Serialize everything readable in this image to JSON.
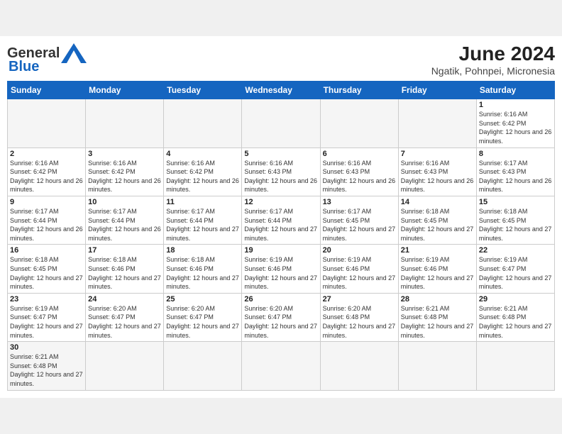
{
  "header": {
    "logo_line1": "General",
    "logo_line2": "Blue",
    "title": "June 2024",
    "subtitle": "Ngatik, Pohnpei, Micronesia"
  },
  "days_of_week": [
    "Sunday",
    "Monday",
    "Tuesday",
    "Wednesday",
    "Thursday",
    "Friday",
    "Saturday"
  ],
  "weeks": [
    [
      {
        "day": "",
        "empty": true
      },
      {
        "day": "",
        "empty": true
      },
      {
        "day": "",
        "empty": true
      },
      {
        "day": "",
        "empty": true
      },
      {
        "day": "",
        "empty": true
      },
      {
        "day": "",
        "empty": true
      },
      {
        "day": "1",
        "sunrise": "6:16 AM",
        "sunset": "6:42 PM",
        "daylight_h": "12",
        "daylight_m": "26"
      }
    ],
    [
      {
        "day": "2",
        "sunrise": "6:16 AM",
        "sunset": "6:42 PM",
        "daylight_h": "12",
        "daylight_m": "26"
      },
      {
        "day": "3",
        "sunrise": "6:16 AM",
        "sunset": "6:42 PM",
        "daylight_h": "12",
        "daylight_m": "26"
      },
      {
        "day": "4",
        "sunrise": "6:16 AM",
        "sunset": "6:42 PM",
        "daylight_h": "12",
        "daylight_m": "26"
      },
      {
        "day": "5",
        "sunrise": "6:16 AM",
        "sunset": "6:43 PM",
        "daylight_h": "12",
        "daylight_m": "26"
      },
      {
        "day": "6",
        "sunrise": "6:16 AM",
        "sunset": "6:43 PM",
        "daylight_h": "12",
        "daylight_m": "26"
      },
      {
        "day": "7",
        "sunrise": "6:16 AM",
        "sunset": "6:43 PM",
        "daylight_h": "12",
        "daylight_m": "26"
      },
      {
        "day": "8",
        "sunrise": "6:17 AM",
        "sunset": "6:43 PM",
        "daylight_h": "12",
        "daylight_m": "26"
      }
    ],
    [
      {
        "day": "9",
        "sunrise": "6:17 AM",
        "sunset": "6:44 PM",
        "daylight_h": "12",
        "daylight_m": "26"
      },
      {
        "day": "10",
        "sunrise": "6:17 AM",
        "sunset": "6:44 PM",
        "daylight_h": "12",
        "daylight_m": "26"
      },
      {
        "day": "11",
        "sunrise": "6:17 AM",
        "sunset": "6:44 PM",
        "daylight_h": "12",
        "daylight_m": "27"
      },
      {
        "day": "12",
        "sunrise": "6:17 AM",
        "sunset": "6:44 PM",
        "daylight_h": "12",
        "daylight_m": "27"
      },
      {
        "day": "13",
        "sunrise": "6:17 AM",
        "sunset": "6:45 PM",
        "daylight_h": "12",
        "daylight_m": "27"
      },
      {
        "day": "14",
        "sunrise": "6:18 AM",
        "sunset": "6:45 PM",
        "daylight_h": "12",
        "daylight_m": "27"
      },
      {
        "day": "15",
        "sunrise": "6:18 AM",
        "sunset": "6:45 PM",
        "daylight_h": "12",
        "daylight_m": "27"
      }
    ],
    [
      {
        "day": "16",
        "sunrise": "6:18 AM",
        "sunset": "6:45 PM",
        "daylight_h": "12",
        "daylight_m": "27"
      },
      {
        "day": "17",
        "sunrise": "6:18 AM",
        "sunset": "6:46 PM",
        "daylight_h": "12",
        "daylight_m": "27"
      },
      {
        "day": "18",
        "sunrise": "6:18 AM",
        "sunset": "6:46 PM",
        "daylight_h": "12",
        "daylight_m": "27"
      },
      {
        "day": "19",
        "sunrise": "6:19 AM",
        "sunset": "6:46 PM",
        "daylight_h": "12",
        "daylight_m": "27"
      },
      {
        "day": "20",
        "sunrise": "6:19 AM",
        "sunset": "6:46 PM",
        "daylight_h": "12",
        "daylight_m": "27"
      },
      {
        "day": "21",
        "sunrise": "6:19 AM",
        "sunset": "6:46 PM",
        "daylight_h": "12",
        "daylight_m": "27"
      },
      {
        "day": "22",
        "sunrise": "6:19 AM",
        "sunset": "6:47 PM",
        "daylight_h": "12",
        "daylight_m": "27"
      }
    ],
    [
      {
        "day": "23",
        "sunrise": "6:19 AM",
        "sunset": "6:47 PM",
        "daylight_h": "12",
        "daylight_m": "27"
      },
      {
        "day": "24",
        "sunrise": "6:20 AM",
        "sunset": "6:47 PM",
        "daylight_h": "12",
        "daylight_m": "27"
      },
      {
        "day": "25",
        "sunrise": "6:20 AM",
        "sunset": "6:47 PM",
        "daylight_h": "12",
        "daylight_m": "27"
      },
      {
        "day": "26",
        "sunrise": "6:20 AM",
        "sunset": "6:47 PM",
        "daylight_h": "12",
        "daylight_m": "27"
      },
      {
        "day": "27",
        "sunrise": "6:20 AM",
        "sunset": "6:48 PM",
        "daylight_h": "12",
        "daylight_m": "27"
      },
      {
        "day": "28",
        "sunrise": "6:21 AM",
        "sunset": "6:48 PM",
        "daylight_h": "12",
        "daylight_m": "27"
      },
      {
        "day": "29",
        "sunrise": "6:21 AM",
        "sunset": "6:48 PM",
        "daylight_h": "12",
        "daylight_m": "27"
      }
    ],
    [
      {
        "day": "30",
        "sunrise": "6:21 AM",
        "sunset": "6:48 PM",
        "daylight_h": "12",
        "daylight_m": "27"
      },
      {
        "day": "",
        "empty": true
      },
      {
        "day": "",
        "empty": true
      },
      {
        "day": "",
        "empty": true
      },
      {
        "day": "",
        "empty": true
      },
      {
        "day": "",
        "empty": true
      },
      {
        "day": "",
        "empty": true
      }
    ]
  ],
  "labels": {
    "sunrise": "Sunrise:",
    "sunset": "Sunset:",
    "daylight": "Daylight: {h} hours and {m} minutes."
  }
}
